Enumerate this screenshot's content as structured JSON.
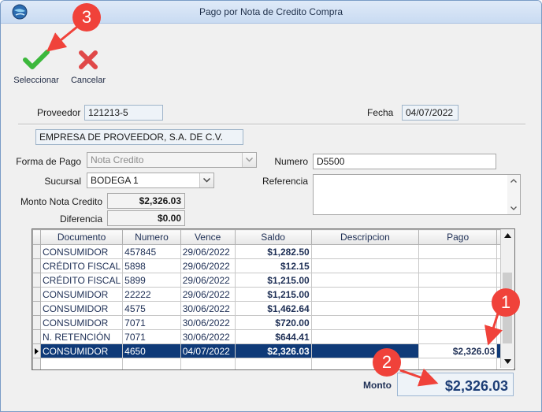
{
  "window": {
    "title": "Pago por Nota de Credito Compra"
  },
  "toolbar": {
    "select_label": "Seleccionar",
    "cancel_label": "Cancelar"
  },
  "form": {
    "proveedor_label": "Proveedor",
    "proveedor_value": "121213-5",
    "fecha_label": "Fecha",
    "fecha_value": "04/07/2022",
    "empresa_value": "EMPRESA DE PROVEEDOR, S.A. DE C.V.",
    "forma_pago_label": "Forma de Pago",
    "forma_pago_value": "Nota Credito",
    "numero_label": "Numero",
    "numero_value": "D5500",
    "sucursal_label": "Sucursal",
    "sucursal_value": "BODEGA 1",
    "referencia_label": "Referencia",
    "monto_nc_label": "Monto Nota Credito",
    "monto_nc_value": "$2,326.03",
    "diferencia_label": "Diferencia",
    "diferencia_value": "$0.00"
  },
  "grid": {
    "columns": [
      "Documento",
      "Numero",
      "Vence",
      "Saldo",
      "Descripcion",
      "Pago"
    ],
    "rows": [
      {
        "documento": "CONSUMIDOR",
        "numero": "457845",
        "vence": "29/06/2022",
        "saldo": "$1,282.50",
        "descripcion": "",
        "pago": "",
        "checked": false
      },
      {
        "documento": "CRÉDITO FISCAL",
        "numero": "5898",
        "vence": "29/06/2022",
        "saldo": "$12.15",
        "descripcion": "",
        "pago": "",
        "checked": false
      },
      {
        "documento": "CRÉDITO FISCAL",
        "numero": "5899",
        "vence": "29/06/2022",
        "saldo": "$1,215.00",
        "descripcion": "",
        "pago": "",
        "checked": false
      },
      {
        "documento": "CONSUMIDOR",
        "numero": "22222",
        "vence": "29/06/2022",
        "saldo": "$1,215.00",
        "descripcion": "",
        "pago": "",
        "checked": false
      },
      {
        "documento": "CONSUMIDOR",
        "numero": "4575",
        "vence": "30/06/2022",
        "saldo": "$1,462.64",
        "descripcion": "",
        "pago": "",
        "checked": false
      },
      {
        "documento": "CONSUMIDOR",
        "numero": "7071",
        "vence": "30/06/2022",
        "saldo": "$720.00",
        "descripcion": "",
        "pago": "",
        "checked": false
      },
      {
        "documento": "N. RETENCIÓN",
        "numero": "7071",
        "vence": "30/06/2022",
        "saldo": "$644.41",
        "descripcion": "",
        "pago": "",
        "checked": false
      },
      {
        "documento": "CONSUMIDOR",
        "numero": "4650",
        "vence": "04/07/2022",
        "saldo": "$2,326.03",
        "descripcion": "",
        "pago": "$2,326.03",
        "checked": true,
        "selected": true
      }
    ]
  },
  "total": {
    "label": "Monto",
    "value": "$2,326.03"
  },
  "callouts": [
    "1",
    "2",
    "3"
  ],
  "colors": {
    "accent": "#f0423a",
    "selection": "#0f3a78",
    "confirm": "#3cb83c",
    "cancel": "#e04848"
  }
}
